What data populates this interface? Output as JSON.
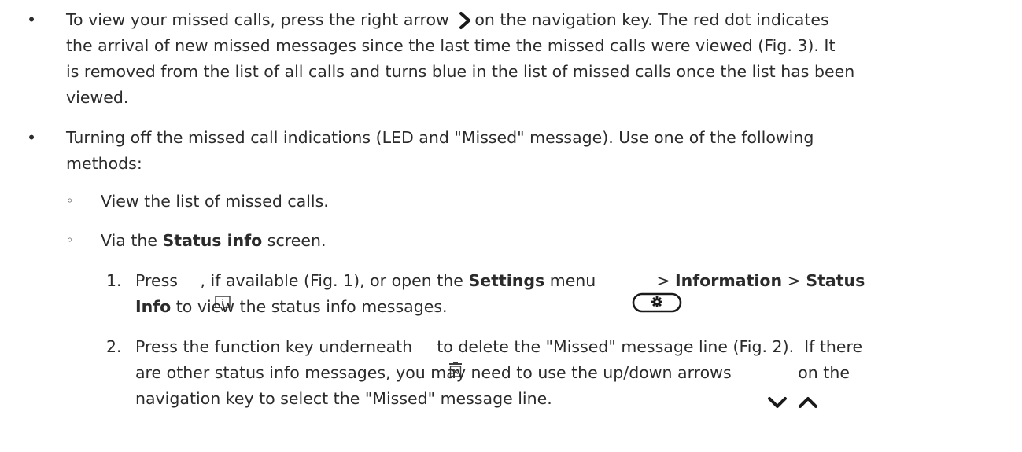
{
  "bullets": {
    "b1": "•",
    "b2": "•",
    "s1": "◦",
    "s2": "◦"
  },
  "item1": {
    "lead": "To view your missed calls, press the right arrow",
    "after_icon": "on the navigation key.  The red dot indicates",
    "line2": "the arrival of new missed messages since the last time the missed calls were viewed (Fig. 3).  It",
    "line3": "is removed from the list of all calls and turns blue in the list of missed calls once the list has been",
    "line4": "viewed."
  },
  "item2": {
    "line1": "Turning off the missed call indications (LED and \"Missed\" message).  Use one of the following",
    "line2": "methods:"
  },
  "sub1": {
    "text": "View the list of missed calls."
  },
  "sub2": {
    "pre": "Via the ",
    "bold": "Status info",
    "post": " screen."
  },
  "step1": {
    "num": "1.",
    "pre": "Press",
    "mid": ", if available (Fig. 1), or open the ",
    "settings": "Settings",
    "menu": " menu",
    "gt1": " > ",
    "information": "Information",
    "gt2": " > ",
    "status": "Status",
    "line2_bold": "Info",
    "line2_post": " to view the status info messages."
  },
  "step2": {
    "num": "2.",
    "pre": "Press the function key underneath",
    "post": "to delete the \"Missed\" message line (Fig. 2).  If there",
    "line2_pre": "are other status info messages, you may need to use the up/down arrows",
    "line2_post": "on the",
    "line3": "navigation key to select the \"Missed\" message line."
  },
  "icons": [
    "chevron-right-icon",
    "info-key-icon",
    "settings-key-icon",
    "delete-icon",
    "chevron-down-icon",
    "chevron-up-icon"
  ]
}
